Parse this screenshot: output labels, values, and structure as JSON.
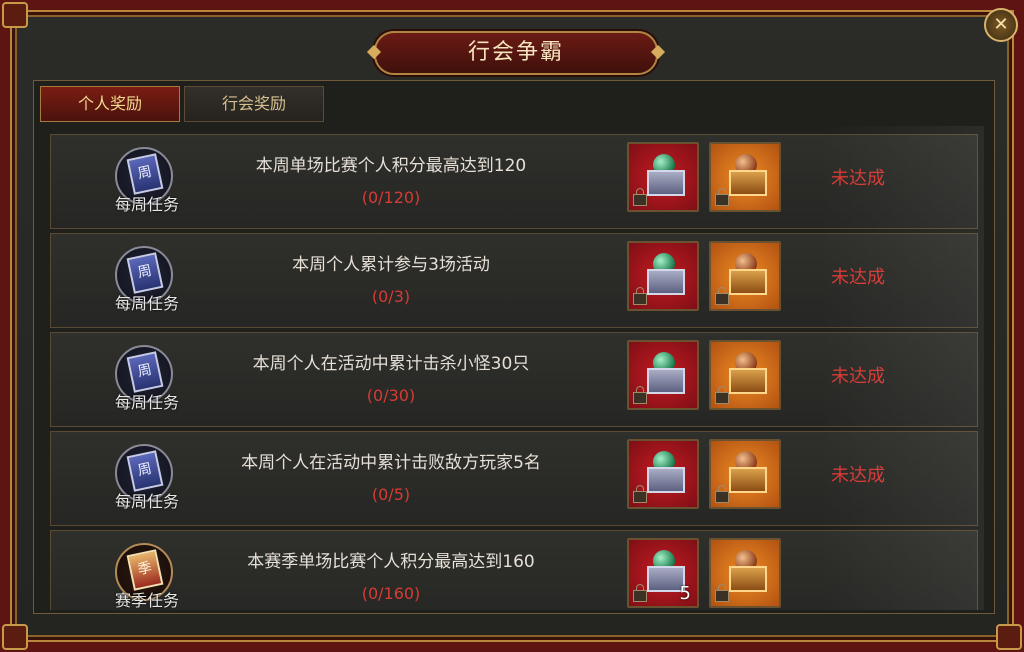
{
  "window": {
    "title": "行会争霸",
    "close_icon": "close-icon"
  },
  "tabs": [
    {
      "label": "个人奖励",
      "active": true
    },
    {
      "label": "行会奖励",
      "active": false
    }
  ],
  "tasks": [
    {
      "type_label": "每周任务",
      "badge_icon": "weekly-badge-icon",
      "badge_glyph": "周",
      "description": "本周单场比赛个人积分最高达到120",
      "progress": "(0/120)",
      "rewards": [
        {
          "icon": "jade-orb-chest-icon",
          "color": "#c61b23",
          "locked": true,
          "qty": ""
        },
        {
          "icon": "bronze-orb-chest-icon",
          "color": "#f08c24",
          "locked": true,
          "qty": ""
        }
      ],
      "status": "未达成"
    },
    {
      "type_label": "每周任务",
      "badge_icon": "weekly-badge-icon",
      "badge_glyph": "周",
      "description": "本周个人累计参与3场活动",
      "progress": "(0/3)",
      "rewards": [
        {
          "icon": "jade-orb-chest-icon",
          "color": "#c61b23",
          "locked": true,
          "qty": ""
        },
        {
          "icon": "bronze-orb-chest-icon",
          "color": "#f08c24",
          "locked": true,
          "qty": ""
        }
      ],
      "status": "未达成"
    },
    {
      "type_label": "每周任务",
      "badge_icon": "weekly-badge-icon",
      "badge_glyph": "周",
      "description": "本周个人在活动中累计击杀小怪30只",
      "progress": "(0/30)",
      "rewards": [
        {
          "icon": "jade-orb-chest-icon",
          "color": "#c61b23",
          "locked": true,
          "qty": ""
        },
        {
          "icon": "bronze-orb-chest-icon",
          "color": "#f08c24",
          "locked": true,
          "qty": ""
        }
      ],
      "status": "未达成"
    },
    {
      "type_label": "每周任务",
      "badge_icon": "weekly-badge-icon",
      "badge_glyph": "周",
      "description": "本周个人在活动中累计击败敌方玩家5名",
      "progress": "(0/5)",
      "rewards": [
        {
          "icon": "jade-orb-chest-icon",
          "color": "#c61b23",
          "locked": true,
          "qty": ""
        },
        {
          "icon": "bronze-orb-chest-icon",
          "color": "#f08c24",
          "locked": true,
          "qty": ""
        }
      ],
      "status": "未达成"
    },
    {
      "type_label": "赛季任务",
      "badge_icon": "season-badge-icon",
      "badge_glyph": "季",
      "description": "本赛季单场比赛个人积分最高达到160",
      "progress": "(0/160)",
      "rewards": [
        {
          "icon": "jade-orb-chest-icon",
          "color": "#c61b23",
          "locked": true,
          "qty": "5"
        },
        {
          "icon": "bronze-orb-chest-icon",
          "color": "#f08c24",
          "locked": true,
          "qty": ""
        }
      ],
      "status": ""
    }
  ]
}
